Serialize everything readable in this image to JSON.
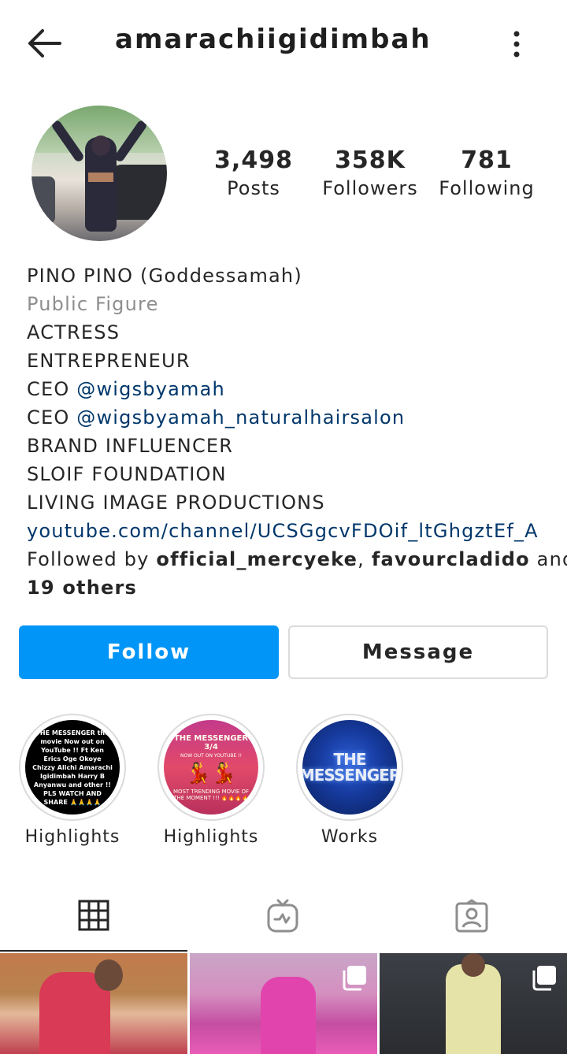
{
  "header": {
    "username": "amarachiigidimbah"
  },
  "stats": {
    "posts_count": "3,498",
    "posts_label": "Posts",
    "followers_count": "358K",
    "followers_label": "Followers",
    "following_count": "781",
    "following_label": "Following"
  },
  "bio": {
    "name": "PINO PINO (Goddessamah)",
    "category": "Public Figure",
    "line_actress": "ACTRESS",
    "line_entrepreneur": "ENTREPRENEUR",
    "ceo_prefix_1": "CEO ",
    "ceo_handle_1": "@wigsbyamah",
    "ceo_prefix_2": "CEO ",
    "ceo_handle_2": "@wigsbyamah_naturalhairsalon",
    "line_brand": "BRAND INFLUENCER",
    "line_foundation": "SLOIF FOUNDATION",
    "line_productions": "LIVING IMAGE PRODUCTIONS",
    "website": "youtube.com/channel/UCSGgcvFDOif_ltGhgztEf_A",
    "followed_by_prefix": "Followed by ",
    "followed_by_user1": "official_mercyeke",
    "followed_by_sep": ", ",
    "followed_by_user2": "favourcladido",
    "followed_by_and": " and",
    "followed_by_others": "19 others"
  },
  "actions": {
    "follow_label": "Follow",
    "message_label": "Message"
  },
  "highlights": [
    {
      "label": "Highlights",
      "cover_text": "THE MESSENGER the movie Now out on YouTube !! Ft Ken Erics Oge Okoye Chizzy Alichi Amarachi Igidimbah Harry B Anyanwu and other !! PLS WATCH AND SHARE 🙏🙏🙏🙏"
    },
    {
      "label": "Highlights",
      "cover_title": "THE MESSENGER 3/4",
      "cover_sub": "NOW OUT ON YOUTUBE !!",
      "cover_bottom": "MOST TRENDING MOVIE OF THE MOMENT !!! 🔥🔥🔥🔥"
    },
    {
      "label": "Works",
      "cover_title": "THE MESSENGER"
    }
  ],
  "tabs": {
    "grid": "grid-icon",
    "igtv": "igtv-icon",
    "tagged": "tagged-icon"
  },
  "colors": {
    "accent": "#0095f6",
    "link": "#00376b",
    "muted": "#8e8e8e"
  }
}
